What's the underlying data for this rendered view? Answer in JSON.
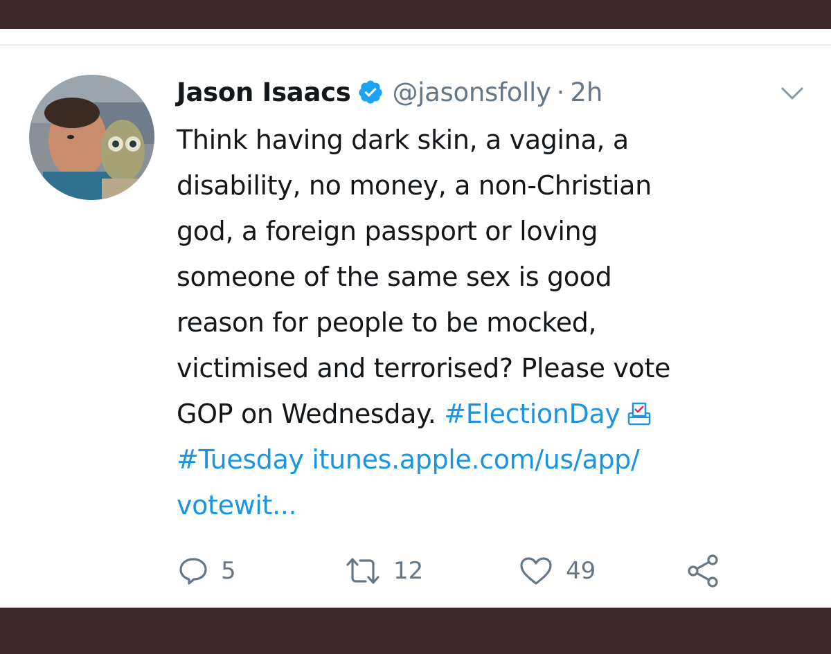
{
  "tweet": {
    "author_name": "Jason Isaacs",
    "handle": "@jasonsfolly",
    "separator": "·",
    "time": "2h",
    "verified": true,
    "text_lines": [
      "Think having dark skin, a vagina, a",
      "disability, no money, a non-Christian",
      "god, a foreign passport or loving",
      "someone of the same sex is good",
      "reason for people to be mocked,",
      "victimised and terrorised? Please vote"
    ],
    "line7_text": "GOP on Wednesday. ",
    "hashtag_1": "#ElectionDay",
    "hashtag_2": "#Tuesday",
    "link_part_1": " itunes.apple.com/us/app/",
    "link_part_2": "votewit...",
    "emoji": "ballot-box-icon",
    "actions": {
      "replies": "5",
      "retweets": "12",
      "likes": "49"
    }
  },
  "colors": {
    "frame": "#3d2727",
    "link": "#1b95e0",
    "muted": "#657786",
    "text": "#14171a",
    "verified": "#1da1f2"
  }
}
